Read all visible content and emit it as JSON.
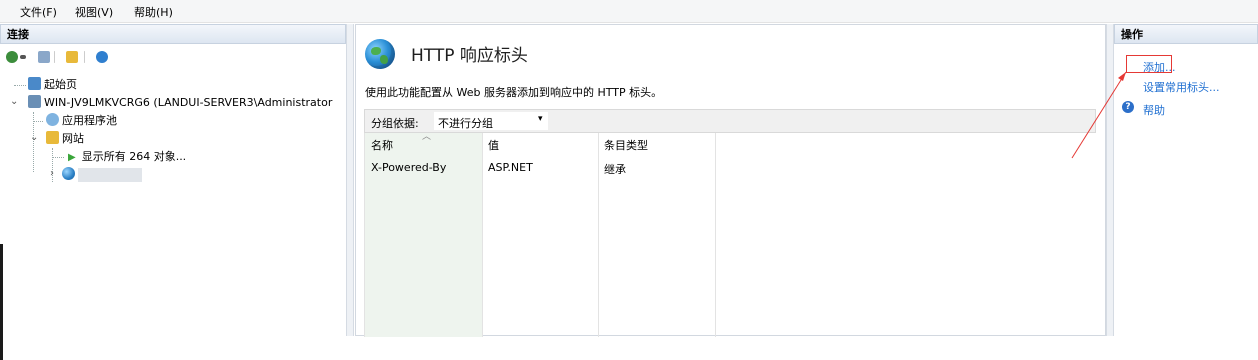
{
  "menu": {
    "file": "文件(F)",
    "view": "视图(V)",
    "help": "帮助(H)"
  },
  "connections": {
    "title": "连接",
    "tree": {
      "start_page": "起始页",
      "server": "WIN-JV9LMKVCRG6 (LANDUI-SERVER3\\Administrator",
      "app_pools": "应用程序池",
      "sites": "网站",
      "show_all": "显示所有 264 对象...",
      "site_blurred": "…"
    }
  },
  "feature": {
    "title": "HTTP 响应标头",
    "description": "使用此功能配置从 Web 服务器添加到响应中的 HTTP 标头。",
    "group_by_label": "分组依据:",
    "group_by_value": "不进行分组",
    "columns": [
      "名称",
      "值",
      "条目类型"
    ],
    "rows": [
      {
        "name": "X-Powered-By",
        "value": "ASP.NET",
        "type": "继承"
      }
    ]
  },
  "actions": {
    "title": "操作",
    "add": "添加...",
    "set_common": "设置常用标头...",
    "help": "帮助"
  },
  "colors": {
    "link": "#1f6fd1",
    "highlight_box": "#e53935",
    "pane_header": "#dde6f1"
  },
  "icons": [
    "globe-icon",
    "server-icon",
    "folder-icon",
    "app-pool-icon",
    "help-icon",
    "play-icon"
  ]
}
